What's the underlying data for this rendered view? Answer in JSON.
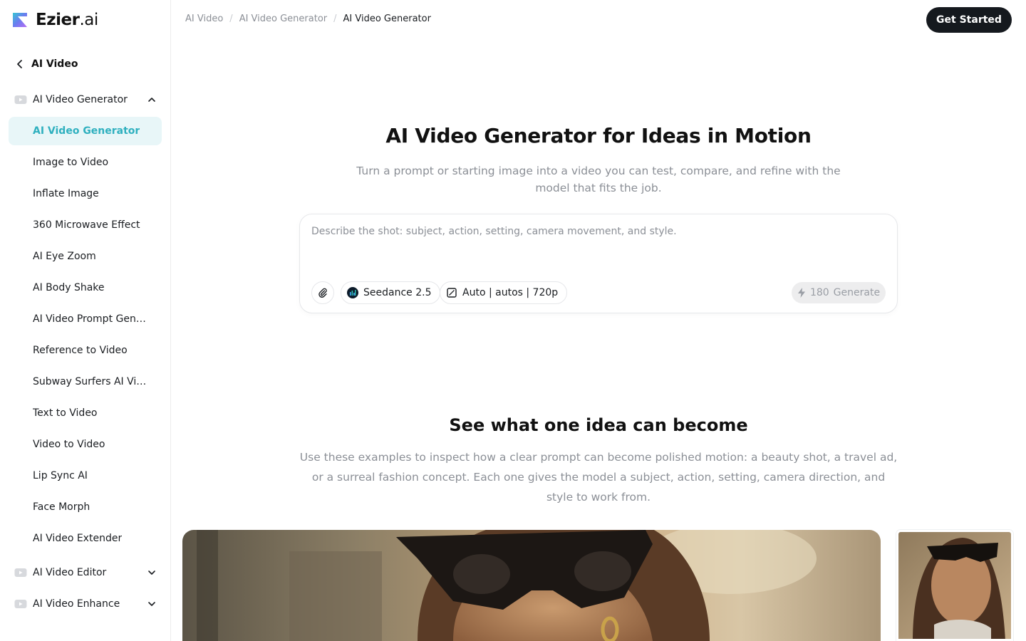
{
  "brand": {
    "name": "Ezier",
    "suffix": ".ai"
  },
  "sidebar": {
    "back_label": "AI Video",
    "groups": [
      {
        "label": "AI Video Generator",
        "expanded": true
      },
      {
        "label": "AI Video Editor",
        "expanded": false
      },
      {
        "label": "AI Video Enhance",
        "expanded": false
      }
    ],
    "items": [
      "AI Video Generator",
      "Image to Video",
      "Inflate Image",
      "360 Microwave Effect",
      "AI Eye Zoom",
      "AI Body Shake",
      "AI Video Prompt Generator",
      "Reference to Video",
      "Subway Surfers AI Video Generator",
      "Text to Video",
      "Video to Video",
      "Lip Sync AI",
      "Face Morph",
      "AI Video Extender"
    ],
    "active_item": "AI Video Generator"
  },
  "header": {
    "breadcrumb": [
      "AI Video",
      "AI Video Generator",
      "AI Video Generator"
    ],
    "cta": "Get Started"
  },
  "hero": {
    "title": "AI Video Generator for Ideas in Motion",
    "subtitle": "Turn a prompt or starting image into a video you can test, compare, and refine with the model that fits the job."
  },
  "prompt": {
    "placeholder": "Describe the shot: subject, action, setting, camera movement, and style.",
    "value": "",
    "model": "Seedance 2.5",
    "settings": "Auto | autos | 720p",
    "credits": "180",
    "generate_label": "Generate"
  },
  "examples": {
    "title": "See what one idea can become",
    "description": "Use these examples to inspect how a clear prompt can become polished motion: a beauty shot, a travel ad, or a surreal fashion concept. Each one gives the model a subject, action, setting, camera direction, and style to work from."
  },
  "colors": {
    "accent": "#2fb0bf",
    "active_bg": "#e8f6f8",
    "cta_bg": "#15191e",
    "muted_text": "#8b8f96"
  },
  "icons": [
    "logo-icon",
    "chevron-left-icon",
    "video-icon",
    "chevron-up-icon",
    "chevron-down-icon",
    "paperclip-icon",
    "model-logo-icon",
    "aspect-ratio-icon",
    "bolt-icon"
  ]
}
